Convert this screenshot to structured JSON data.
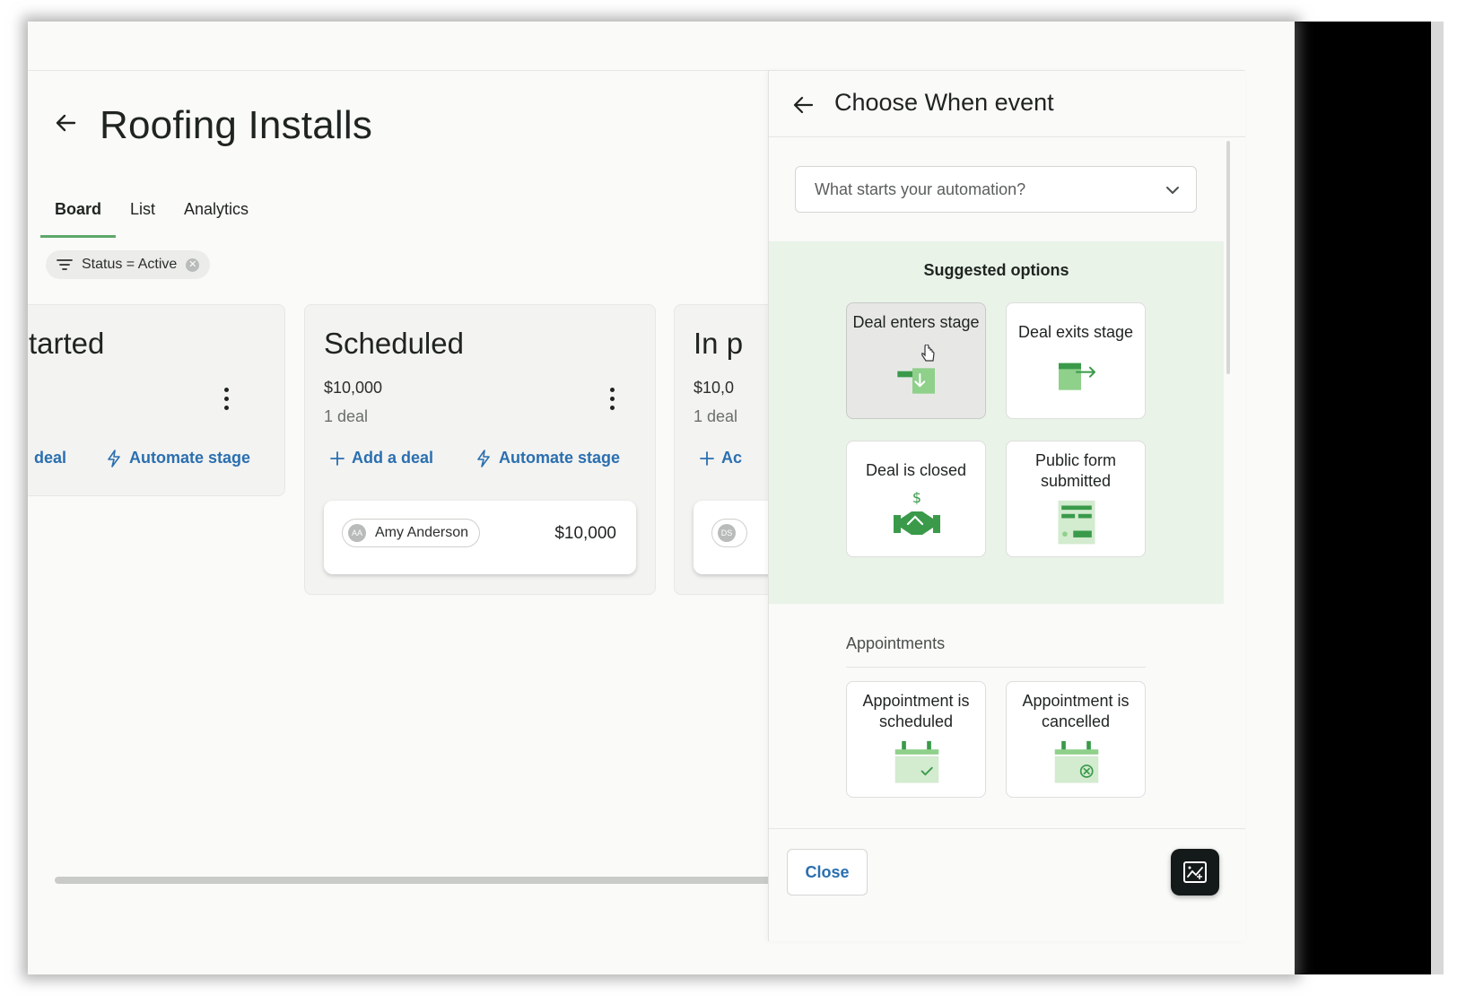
{
  "page": {
    "title": "Roofing Installs",
    "tabs": [
      {
        "label": "Board",
        "active": true
      },
      {
        "label": "List",
        "active": false
      },
      {
        "label": "Analytics",
        "active": false
      }
    ],
    "filter": "Status = Active"
  },
  "columns": [
    {
      "title": "tarted",
      "actions": {
        "add": "deal",
        "automate": "Automate stage"
      }
    },
    {
      "title": "Scheduled",
      "amount": "$10,000",
      "count": "1 deal",
      "actions": {
        "add": "Add a deal",
        "automate": "Automate stage"
      },
      "deal": {
        "avatar": "AA",
        "name": "Amy Anderson",
        "value": "$10,000"
      }
    },
    {
      "title": "In p",
      "amount": "$10,0",
      "count": "1 deal",
      "actions": {
        "add": "Ac"
      },
      "deal": {
        "avatar": "DS"
      }
    }
  ],
  "panel": {
    "title": "Choose When event",
    "select_placeholder": "What starts your automation?",
    "suggested_title": "Suggested options",
    "suggested": [
      {
        "label": "Deal enters stage",
        "icon": "deal-enters-stage-icon",
        "selected": true
      },
      {
        "label": "Deal exits stage",
        "icon": "deal-exits-stage-icon",
        "selected": false
      },
      {
        "label": "Deal is closed",
        "icon": "handshake-dollar-icon",
        "selected": false
      },
      {
        "label": "Public form submitted",
        "icon": "form-icon",
        "selected": false
      }
    ],
    "appointments_title": "Appointments",
    "appointments": [
      {
        "label": "Appointment is scheduled",
        "icon": "calendar-check-icon"
      },
      {
        "label": "Appointment is cancelled",
        "icon": "calendar-cancel-icon"
      }
    ],
    "close_label": "Close"
  },
  "colors": {
    "accent_green": "#5fa86a",
    "link_blue": "#2a6fb0",
    "suggested_bg": "#e9f3e8"
  }
}
